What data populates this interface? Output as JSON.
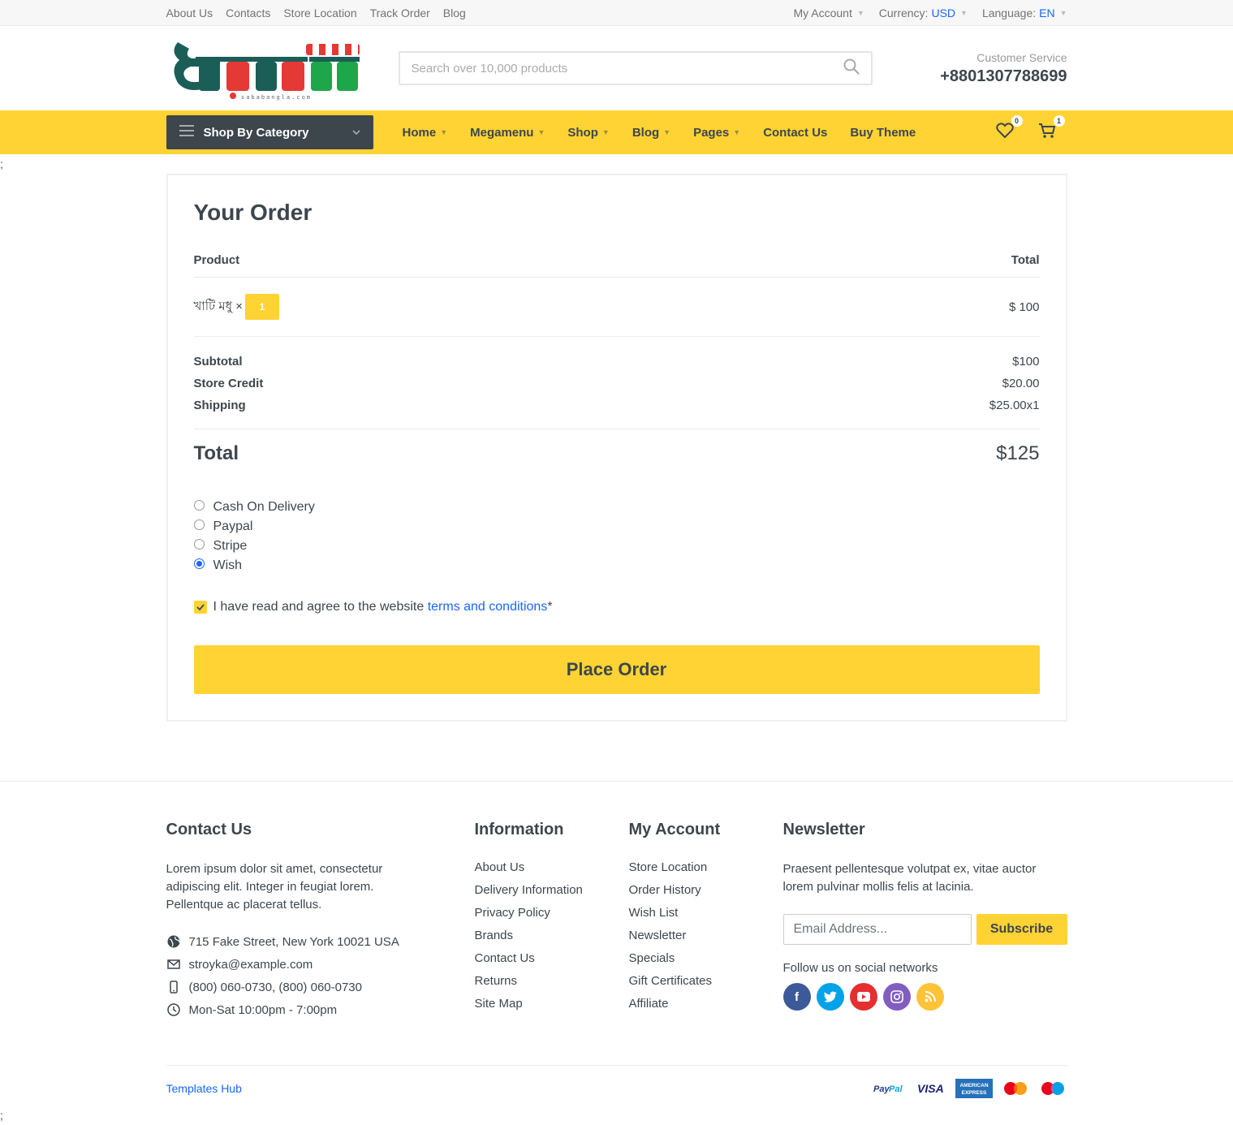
{
  "topbar": {
    "links": [
      "About Us",
      "Contacts",
      "Store Location",
      "Track Order",
      "Blog"
    ],
    "account": "My Account",
    "currency_label": "Currency:",
    "currency_value": "USD",
    "language_label": "Language:",
    "language_value": "EN"
  },
  "header": {
    "search_placeholder": "Search over 10,000 products",
    "service_label": "Customer Service",
    "phone": "+8801307788699",
    "logo_text": "সবাবাংলা",
    "logo_sub": "sababangla.com"
  },
  "nav": {
    "category_label": "Shop By Category",
    "items": [
      "Home",
      "Megamenu",
      "Shop",
      "Blog",
      "Pages",
      "Contact Us",
      "Buy Theme"
    ],
    "wishlist_count": "0",
    "cart_count": "1"
  },
  "stray_semicolon": ";",
  "order": {
    "title": "Your Order",
    "col_product": "Product",
    "col_total": "Total",
    "product_name": "খাটি মধু ×",
    "product_qty": "1",
    "product_total": "$ 100",
    "subtotal_label": "Subtotal",
    "subtotal_value": "$100",
    "credit_label": "Store Credit",
    "credit_value": "$20.00",
    "shipping_label": "Shipping",
    "shipping_value": "$25.00x1",
    "total_label": "Total",
    "total_value": "$125",
    "payments": [
      "Cash On Delivery",
      "Paypal",
      "Stripe",
      "Wish"
    ],
    "selected_payment": "Wish",
    "agree_text": "I have read and agree to the website ",
    "agree_link": "terms and conditions",
    "agree_star": "*",
    "place_order": "Place Order"
  },
  "footer": {
    "contact_title": "Contact Us",
    "contact_text": "Lorem ipsum dolor sit amet, consectetur adipiscing elit. Integer in feugiat lorem. Pellentque ac placerat tellus.",
    "address": "715 Fake Street, New York 10021 USA",
    "email": "stroyka@example.com",
    "phones": "(800) 060-0730, (800) 060-0730",
    "hours": "Mon-Sat 10:00pm - 7:00pm",
    "info_title": "Information",
    "info_links": [
      "About Us",
      "Delivery Information",
      "Privacy Policy",
      "Brands",
      "Contact Us",
      "Returns",
      "Site Map"
    ],
    "account_title": "My Account",
    "account_links": [
      "Store Location",
      "Order History",
      "Wish List",
      "Newsletter",
      "Specials",
      "Gift Certificates",
      "Affiliate"
    ],
    "news_title": "Newsletter",
    "news_text": "Praesent pellentesque volutpat ex, vitae auctor lorem pulvinar mollis felis at lacinia.",
    "email_placeholder": "Email Address...",
    "subscribe": "Subscribe",
    "follow": "Follow us on social networks",
    "credit": "Templates Hub"
  },
  "colors": {
    "accent": "#ffd333",
    "dark": "#3d464d",
    "link": "#1a66ff"
  }
}
